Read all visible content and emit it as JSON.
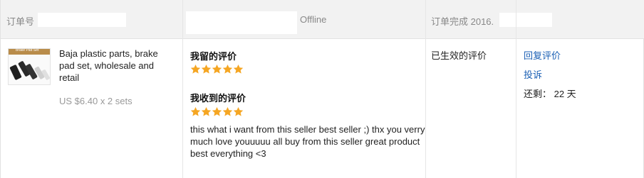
{
  "header": {
    "order_label": "订单号",
    "offline_label": "Offline",
    "order_done_label": "订单完成 2016."
  },
  "product": {
    "thumbnail_caption": "Brake Pad Set",
    "name": "Baja plastic parts, brake pad set, wholesale and retail",
    "price_qty": "US $6.40 x 2 sets"
  },
  "feedback": {
    "my_review_label": "我留的评价",
    "my_rating": 5,
    "received_review_label": "我收到的评价",
    "received_rating": 5,
    "received_comment": "this what i want from this seller best seller ;) thx you verry much love youuuuu all buy from this seller great product best everything <3",
    "star_color": "#f5a623"
  },
  "status": {
    "text": "已生效的评价"
  },
  "actions": {
    "reply_label": "回复评价",
    "complain_label": "投诉",
    "remaining_text": "还剩： 22 天",
    "link_color": "#1a5fb4"
  }
}
